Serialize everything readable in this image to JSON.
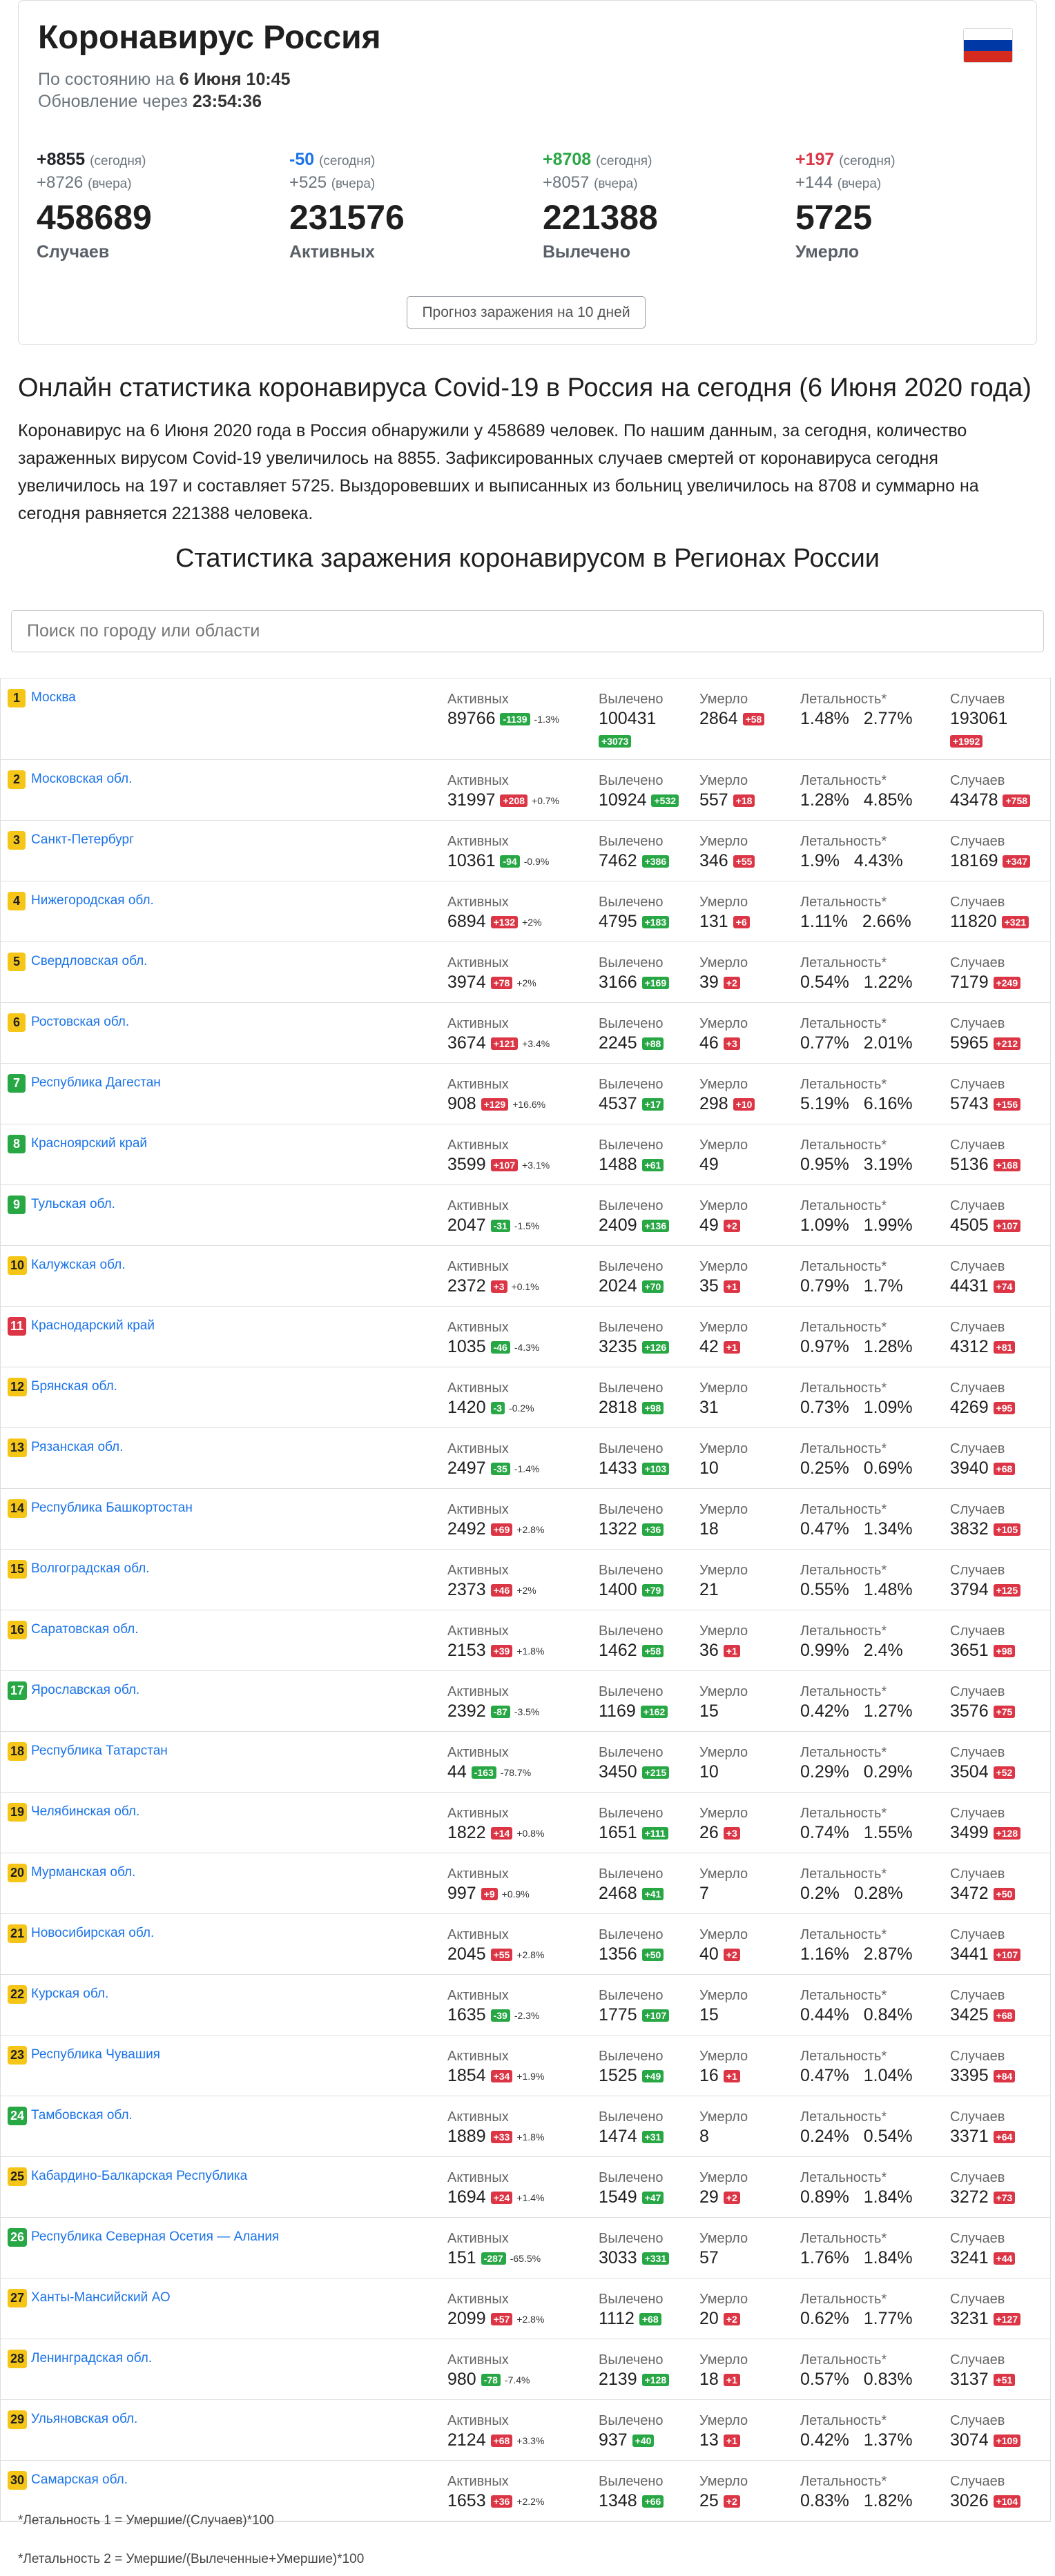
{
  "header": {
    "title": "Коронавирус Россия",
    "state_prefix": "По состоянию на",
    "state_time": "6 Июня 10:45",
    "update_prefix": "Обновление через",
    "update_time": "23:54:36",
    "flag_colors": [
      "#ffffff",
      "#0039a6",
      "#d52b1e"
    ]
  },
  "stats": [
    {
      "today": "+8855",
      "today_color": "#212529",
      "yesterday": "+8726",
      "total": "458689",
      "label": "Случаев"
    },
    {
      "today": "-50",
      "today_color": "#1a73e8",
      "yesterday": "+525",
      "total": "231576",
      "label": "Активных"
    },
    {
      "today": "+8708",
      "today_color": "#28a745",
      "yesterday": "+8057",
      "total": "221388",
      "label": "Вылечено"
    },
    {
      "today": "+197",
      "today_color": "#dc3545",
      "yesterday": "+144",
      "total": "5725",
      "label": "Умерло"
    }
  ],
  "today_label": "(сегодня)",
  "yesterday_label": "(вчера)",
  "forecast_button": "Прогноз заражения на 10 дней",
  "headline": "Онлайн статистика коронавируса Covid-19 в Россия на сегодня (6 Июня 2020 года)",
  "paragraph": "Коронавирус на 6 Июня 2020 года в Россия обнаружили у 458689 человек. По нашим данным, за сегодня, количество зараженных вирусом Covid-19 увеличилось на 8855. Зафиксированных случаев смертей от коронавируса сегодня увеличилось на 197 и составляет 5725. Выздоровевших и выписанных из больниц увеличилось на 8708 и суммарно на сегодня равняется 221388 человека.",
  "regions_title": "Статистика заражения коронавирусом в Регионах России",
  "search_placeholder": "Поиск по городу или области",
  "col_labels": {
    "active": "Активных",
    "recovered": "Вылечено",
    "deaths": "Умерло",
    "lethality": "Летальность*",
    "cases": "Случаев"
  },
  "regions": [
    {
      "n": "1",
      "nc": "y",
      "name": "Москва",
      "active": "89766",
      "ad": "-1139",
      "ac": "g",
      "ap": "-1.3%",
      "rec": "100431",
      "rd": "+3073",
      "rnl": true,
      "dead": "2864",
      "dd": "+58",
      "l1": "1.48%",
      "l2": "2.77%",
      "cases": "193061",
      "cd": "+1992",
      "cnl": true
    },
    {
      "n": "2",
      "nc": "y",
      "name": "Московская обл.",
      "active": "31997",
      "ad": "+208",
      "ac": "r",
      "ap": "+0.7%",
      "rec": "10924",
      "rd": "+532",
      "dead": "557",
      "dd": "+18",
      "l1": "1.28%",
      "l2": "4.85%",
      "cases": "43478",
      "cd": "+758"
    },
    {
      "n": "3",
      "nc": "y",
      "name": "Санкт-Петербург",
      "active": "10361",
      "ad": "-94",
      "ac": "g",
      "ap": "-0.9%",
      "rec": "7462",
      "rd": "+386",
      "dead": "346",
      "dd": "+55",
      "l1": "1.9%",
      "l2": "4.43%",
      "cases": "18169",
      "cd": "+347"
    },
    {
      "n": "4",
      "nc": "y",
      "name": "Нижегородская обл.",
      "active": "6894",
      "ad": "+132",
      "ac": "r",
      "ap": "+2%",
      "rec": "4795",
      "rd": "+183",
      "dead": "131",
      "dd": "+6",
      "l1": "1.11%",
      "l2": "2.66%",
      "cases": "11820",
      "cd": "+321"
    },
    {
      "n": "5",
      "nc": "y",
      "name": "Свердловская обл.",
      "active": "3974",
      "ad": "+78",
      "ac": "r",
      "ap": "+2%",
      "rec": "3166",
      "rd": "+169",
      "dead": "39",
      "dd": "+2",
      "l1": "0.54%",
      "l2": "1.22%",
      "cases": "7179",
      "cd": "+249"
    },
    {
      "n": "6",
      "nc": "y",
      "name": "Ростовская обл.",
      "active": "3674",
      "ad": "+121",
      "ac": "r",
      "ap": "+3.4%",
      "rec": "2245",
      "rd": "+88",
      "dead": "46",
      "dd": "+3",
      "l1": "0.77%",
      "l2": "2.01%",
      "cases": "5965",
      "cd": "+212"
    },
    {
      "n": "7",
      "nc": "g",
      "name": "Республика Дагестан",
      "active": "908",
      "ad": "+129",
      "ac": "r",
      "ap": "+16.6%",
      "rec": "4537",
      "rd": "+17",
      "dead": "298",
      "dd": "+10",
      "l1": "5.19%",
      "l2": "6.16%",
      "cases": "5743",
      "cd": "+156"
    },
    {
      "n": "8",
      "nc": "g",
      "name": "Красноярский край",
      "active": "3599",
      "ad": "+107",
      "ac": "r",
      "ap": "+3.1%",
      "rec": "1488",
      "rd": "+61",
      "dead": "49",
      "dd": "",
      "l1": "0.95%",
      "l2": "3.19%",
      "cases": "5136",
      "cd": "+168"
    },
    {
      "n": "9",
      "nc": "g",
      "name": "Тульская обл.",
      "active": "2047",
      "ad": "-31",
      "ac": "g",
      "ap": "-1.5%",
      "rec": "2409",
      "rd": "+136",
      "dead": "49",
      "dd": "+2",
      "l1": "1.09%",
      "l2": "1.99%",
      "cases": "4505",
      "cd": "+107"
    },
    {
      "n": "10",
      "nc": "y",
      "name": "Калужская обл.",
      "active": "2372",
      "ad": "+3",
      "ac": "r",
      "ap": "+0.1%",
      "rec": "2024",
      "rd": "+70",
      "dead": "35",
      "dd": "+1",
      "l1": "0.79%",
      "l2": "1.7%",
      "cases": "4431",
      "cd": "+74"
    },
    {
      "n": "11",
      "nc": "r",
      "name": "Краснодарский край",
      "active": "1035",
      "ad": "-46",
      "ac": "g",
      "ap": "-4.3%",
      "rec": "3235",
      "rd": "+126",
      "dead": "42",
      "dd": "+1",
      "l1": "0.97%",
      "l2": "1.28%",
      "cases": "4312",
      "cd": "+81"
    },
    {
      "n": "12",
      "nc": "y",
      "name": "Брянская обл.",
      "active": "1420",
      "ad": "-3",
      "ac": "g",
      "ap": "-0.2%",
      "rec": "2818",
      "rd": "+98",
      "dead": "31",
      "dd": "",
      "l1": "0.73%",
      "l2": "1.09%",
      "cases": "4269",
      "cd": "+95"
    },
    {
      "n": "13",
      "nc": "y",
      "name": "Рязанская обл.",
      "active": "2497",
      "ad": "-35",
      "ac": "g",
      "ap": "-1.4%",
      "rec": "1433",
      "rd": "+103",
      "dead": "10",
      "dd": "",
      "l1": "0.25%",
      "l2": "0.69%",
      "cases": "3940",
      "cd": "+68"
    },
    {
      "n": "14",
      "nc": "y",
      "name": "Республика Башкортостан",
      "active": "2492",
      "ad": "+69",
      "ac": "r",
      "ap": "+2.8%",
      "rec": "1322",
      "rd": "+36",
      "dead": "18",
      "dd": "",
      "l1": "0.47%",
      "l2": "1.34%",
      "cases": "3832",
      "cd": "+105"
    },
    {
      "n": "15",
      "nc": "y",
      "name": "Волгоградская обл.",
      "active": "2373",
      "ad": "+46",
      "ac": "r",
      "ap": "+2%",
      "rec": "1400",
      "rd": "+79",
      "dead": "21",
      "dd": "",
      "l1": "0.55%",
      "l2": "1.48%",
      "cases": "3794",
      "cd": "+125"
    },
    {
      "n": "16",
      "nc": "y",
      "name": "Саратовская обл.",
      "active": "2153",
      "ad": "+39",
      "ac": "r",
      "ap": "+1.8%",
      "rec": "1462",
      "rd": "+58",
      "dead": "36",
      "dd": "+1",
      "l1": "0.99%",
      "l2": "2.4%",
      "cases": "3651",
      "cd": "+98"
    },
    {
      "n": "17",
      "nc": "g",
      "name": "Ярославская обл.",
      "active": "2392",
      "ad": "-87",
      "ac": "g",
      "ap": "-3.5%",
      "rec": "1169",
      "rd": "+162",
      "dead": "15",
      "dd": "",
      "l1": "0.42%",
      "l2": "1.27%",
      "cases": "3576",
      "cd": "+75"
    },
    {
      "n": "18",
      "nc": "y",
      "name": "Республика Татарстан",
      "active": "44",
      "ad": "-163",
      "ac": "g",
      "ap": "-78.7%",
      "rec": "3450",
      "rd": "+215",
      "dead": "10",
      "dd": "",
      "l1": "0.29%",
      "l2": "0.29%",
      "cases": "3504",
      "cd": "+52"
    },
    {
      "n": "19",
      "nc": "y",
      "name": "Челябинская обл.",
      "active": "1822",
      "ad": "+14",
      "ac": "r",
      "ap": "+0.8%",
      "rec": "1651",
      "rd": "+111",
      "dead": "26",
      "dd": "+3",
      "l1": "0.74%",
      "l2": "1.55%",
      "cases": "3499",
      "cd": "+128"
    },
    {
      "n": "20",
      "nc": "y",
      "name": "Мурманская обл.",
      "active": "997",
      "ad": "+9",
      "ac": "r",
      "ap": "+0.9%",
      "rec": "2468",
      "rd": "+41",
      "dead": "7",
      "dd": "",
      "l1": "0.2%",
      "l2": "0.28%",
      "cases": "3472",
      "cd": "+50"
    },
    {
      "n": "21",
      "nc": "y",
      "name": "Новосибирская обл.",
      "active": "2045",
      "ad": "+55",
      "ac": "r",
      "ap": "+2.8%",
      "rec": "1356",
      "rd": "+50",
      "dead": "40",
      "dd": "+2",
      "l1": "1.16%",
      "l2": "2.87%",
      "cases": "3441",
      "cd": "+107"
    },
    {
      "n": "22",
      "nc": "y",
      "name": "Курская обл.",
      "active": "1635",
      "ad": "-39",
      "ac": "g",
      "ap": "-2.3%",
      "rec": "1775",
      "rd": "+107",
      "dead": "15",
      "dd": "",
      "l1": "0.44%",
      "l2": "0.84%",
      "cases": "3425",
      "cd": "+68"
    },
    {
      "n": "23",
      "nc": "y",
      "name": "Республика Чувашия",
      "active": "1854",
      "ad": "+34",
      "ac": "r",
      "ap": "+1.9%",
      "rec": "1525",
      "rd": "+49",
      "dead": "16",
      "dd": "+1",
      "l1": "0.47%",
      "l2": "1.04%",
      "cases": "3395",
      "cd": "+84"
    },
    {
      "n": "24",
      "nc": "g",
      "name": "Тамбовская обл.",
      "active": "1889",
      "ad": "+33",
      "ac": "r",
      "ap": "+1.8%",
      "rec": "1474",
      "rd": "+31",
      "dead": "8",
      "dd": "",
      "l1": "0.24%",
      "l2": "0.54%",
      "cases": "3371",
      "cd": "+64"
    },
    {
      "n": "25",
      "nc": "y",
      "name": "Кабардино-Балкарская Республика",
      "active": "1694",
      "ad": "+24",
      "ac": "r",
      "ap": "+1.4%",
      "rec": "1549",
      "rd": "+47",
      "dead": "29",
      "dd": "+2",
      "l1": "0.89%",
      "l2": "1.84%",
      "cases": "3272",
      "cd": "+73"
    },
    {
      "n": "26",
      "nc": "g",
      "name": "Республика Северная Осетия — Алания",
      "active": "151",
      "ad": "-287",
      "ac": "g",
      "ap": "-65.5%",
      "rec": "3033",
      "rd": "+331",
      "dead": "57",
      "dd": "",
      "l1": "1.76%",
      "l2": "1.84%",
      "cases": "3241",
      "cd": "+44"
    },
    {
      "n": "27",
      "nc": "y",
      "name": "Ханты-Мансийский АО",
      "active": "2099",
      "ad": "+57",
      "ac": "r",
      "ap": "+2.8%",
      "rec": "1112",
      "rd": "+68",
      "dead": "20",
      "dd": "+2",
      "l1": "0.62%",
      "l2": "1.77%",
      "cases": "3231",
      "cd": "+127"
    },
    {
      "n": "28",
      "nc": "y",
      "name": "Ленинградская обл.",
      "active": "980",
      "ad": "-78",
      "ac": "g",
      "ap": "-7.4%",
      "rec": "2139",
      "rd": "+128",
      "dead": "18",
      "dd": "+1",
      "l1": "0.57%",
      "l2": "0.83%",
      "cases": "3137",
      "cd": "+51"
    },
    {
      "n": "29",
      "nc": "y",
      "name": "Ульяновская обл.",
      "active": "2124",
      "ad": "+68",
      "ac": "r",
      "ap": "+3.3%",
      "rec": "937",
      "rd": "+40",
      "dead": "13",
      "dd": "+1",
      "l1": "0.42%",
      "l2": "1.37%",
      "cases": "3074",
      "cd": "+109"
    },
    {
      "n": "30",
      "nc": "y",
      "name": "Самарская обл.",
      "active": "1653",
      "ad": "+36",
      "ac": "r",
      "ap": "+2.2%",
      "rec": "1348",
      "rd": "+66",
      "dead": "25",
      "dd": "+2",
      "l1": "0.83%",
      "l2": "1.82%",
      "cases": "3026",
      "cd": "+104"
    }
  ],
  "notes": [
    "*Летальность 1 = Умершие/(Случаев)*100",
    "*Летальность 2 = Умершие/(Вылеченные+Умершие)*100"
  ]
}
